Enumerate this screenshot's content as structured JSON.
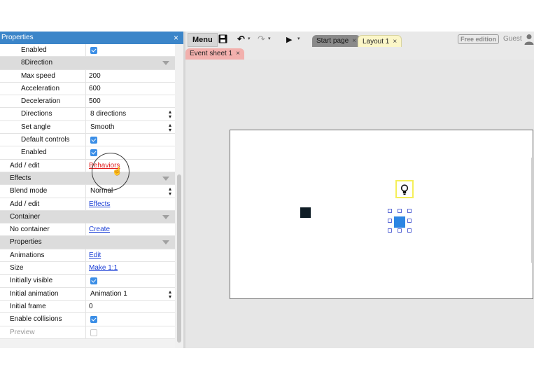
{
  "properties_panel": {
    "title": "Properties",
    "close_glyph": "×",
    "rows": [
      {
        "type": "prop",
        "label": "Enabled",
        "indent": true,
        "value_kind": "checkbox",
        "checked": true
      },
      {
        "type": "category",
        "label": "8Direction",
        "indent": true
      },
      {
        "type": "prop",
        "label": "Max speed",
        "indent": true,
        "value_kind": "text",
        "value": "200"
      },
      {
        "type": "prop",
        "label": "Acceleration",
        "indent": true,
        "value_kind": "text",
        "value": "600"
      },
      {
        "type": "prop",
        "label": "Deceleration",
        "indent": true,
        "value_kind": "text",
        "value": "500"
      },
      {
        "type": "prop",
        "label": "Directions",
        "indent": true,
        "value_kind": "select",
        "value": "8 directions"
      },
      {
        "type": "prop",
        "label": "Set angle",
        "indent": true,
        "value_kind": "select",
        "value": "Smooth"
      },
      {
        "type": "prop",
        "label": "Default controls",
        "indent": true,
        "value_kind": "checkbox",
        "checked": true
      },
      {
        "type": "prop",
        "label": "Enabled",
        "indent": true,
        "value_kind": "checkbox",
        "checked": true
      },
      {
        "type": "prop",
        "label": "Add / edit",
        "value_kind": "link-red",
        "value": "Behaviors"
      },
      {
        "type": "category",
        "label": "Effects"
      },
      {
        "type": "prop",
        "label": "Blend mode",
        "value_kind": "select",
        "value": "Normal"
      },
      {
        "type": "prop",
        "label": "Add / edit",
        "value_kind": "link",
        "value": "Effects"
      },
      {
        "type": "category",
        "label": "Container"
      },
      {
        "type": "prop",
        "label": "No container",
        "value_kind": "link",
        "value": "Create"
      },
      {
        "type": "category",
        "label": "Properties"
      },
      {
        "type": "prop",
        "label": "Animations",
        "value_kind": "link",
        "value": "Edit"
      },
      {
        "type": "prop",
        "label": "Size",
        "value_kind": "link",
        "value": "Make 1:1"
      },
      {
        "type": "prop",
        "label": "Initially visible",
        "value_kind": "checkbox",
        "checked": true
      },
      {
        "type": "prop",
        "label": "Initial animation",
        "value_kind": "select",
        "value": "Animation 1"
      },
      {
        "type": "prop",
        "label": "Initial frame",
        "value_kind": "text",
        "value": "0"
      },
      {
        "type": "prop",
        "label": "Enable collisions",
        "value_kind": "checkbox",
        "checked": true
      },
      {
        "type": "prop",
        "label": "Preview",
        "value_kind": "checkbox",
        "checked": false,
        "muted": true
      }
    ]
  },
  "toolbar": {
    "menu_label": "Menu",
    "save_icon": "floppy-disk-icon",
    "undo_glyph": "↶",
    "redo_glyph": "↷",
    "run_glyph": "▶",
    "caret_glyph": "▾",
    "tabs": [
      {
        "label": "Start page",
        "close": "×"
      },
      {
        "label": "Layout 1",
        "close": "×"
      }
    ],
    "edition_badge": "Free edition",
    "user_label": "Guest"
  },
  "subtabs": {
    "event_sheet": {
      "label": "Event sheet 1",
      "close": "×"
    }
  },
  "layout": {
    "bulb_glyph": "💡",
    "colors": {
      "accent": "#3b85c9",
      "checkbox": "#3b8ee6",
      "event_tab": "#f2b0ad",
      "layout_tab": "#fbf6c8",
      "sprite_dark": "#0f1d26",
      "sprite_blue": "#2d86e3",
      "bulb_border": "#f5ef5a"
    }
  }
}
